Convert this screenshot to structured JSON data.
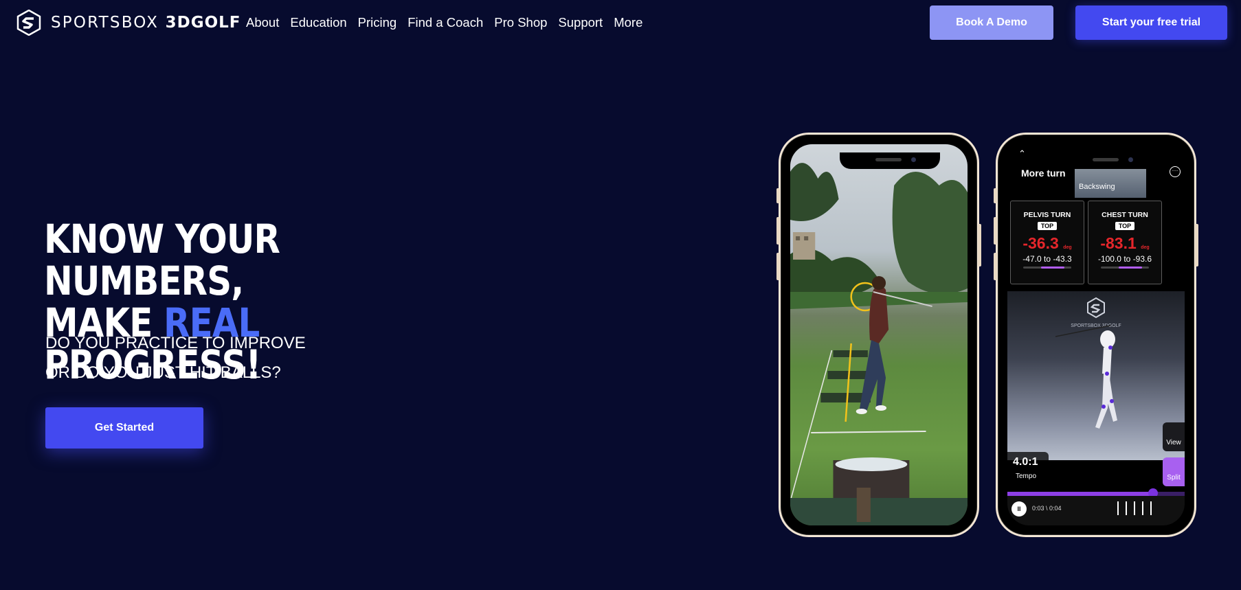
{
  "brand": {
    "name_light": "SPORTSBOX",
    "name_bold": "3DGOLF",
    "icon": "sportsbox-logo-icon"
  },
  "nav": {
    "items": [
      "About",
      "Education",
      "Pricing",
      "Find a Coach",
      "Pro Shop",
      "Support",
      "More"
    ],
    "demo_label": "Book A Demo",
    "trial_label": "Start your free trial"
  },
  "hero": {
    "headline_line1": "KNOW YOUR NUMBERS,",
    "headline_line2_pre": "MAKE ",
    "headline_line2_accent": "REAL",
    "headline_line2_post": " PROGRESS!",
    "sub_line1": "DO YOU PRACTICE TO IMPROVE",
    "sub_line2": "OR DO YOU JUST HIT BALLS?",
    "cta_label": "Get Started"
  },
  "app_screen": {
    "title": "More turn",
    "thumb_label": "Backswing",
    "metrics": [
      {
        "name": "PELVIS TURN",
        "tag": "TOP",
        "value": "-36.3",
        "unit": "deg",
        "range_low": "-47.0",
        "range_to": "to",
        "range_high": "-43.3"
      },
      {
        "name": "CHEST TURN",
        "tag": "TOP",
        "value": "-83.1",
        "unit": "deg",
        "range_low": "-100.0",
        "range_to": "to",
        "range_high": "-93.6"
      }
    ],
    "model_brand": "SPORTSBOX 3DGOLF",
    "tempo_value": "4.0:1",
    "tempo_label": "Tempo",
    "view_label": "View",
    "split_label": "Split",
    "time": "0:03 \\ 0:04",
    "playback_progress": 0.82
  },
  "colors": {
    "background": "#070b2e",
    "accent": "#4a6cf7",
    "primary_button": "#4349f0",
    "demo_button": "#8d95f4",
    "metric_red": "#e5262b",
    "timeline_purple": "#8d3fe6"
  }
}
